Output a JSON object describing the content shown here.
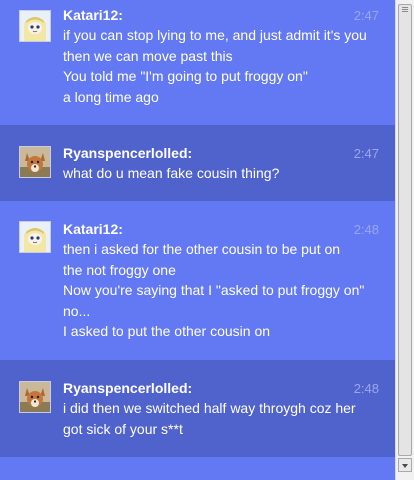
{
  "messages": [
    {
      "sender": "Katari12:",
      "time": "2:47",
      "avatar": "cartoon-character-avatar",
      "lines": [
        "if you can stop lying to me, and just admit it's you",
        "then we can move past this",
        "You told me \"I'm going to put froggy on\"",
        "a long time ago"
      ]
    },
    {
      "sender": "Ryanspencerlolled:",
      "time": "2:47",
      "avatar": "dog-photo-avatar",
      "lines": [
        "what do u mean fake cousin thing?"
      ]
    },
    {
      "sender": "Katari12:",
      "time": "2:48",
      "avatar": "cartoon-character-avatar",
      "lines": [
        "then i asked for the other cousin to be put on",
        "the not froggy one",
        "Now you're saying that I \"asked to put froggy on\"",
        "no...",
        "I asked to put the other cousin on"
      ]
    },
    {
      "sender": "Ryanspencerlolled:",
      "time": "2:48",
      "avatar": "dog-photo-avatar",
      "lines": [
        "i did then we switched half way throygh coz her",
        "got sick of your s**t"
      ]
    }
  ],
  "colors": {
    "light_row": "#6379f3",
    "dark_row": "#5062cc",
    "text": "#ffffff",
    "timestamp": "#9aa6ec"
  }
}
